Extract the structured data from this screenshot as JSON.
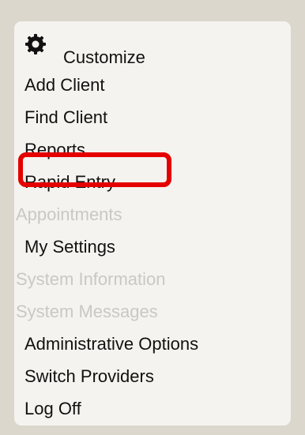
{
  "menu": {
    "customize": {
      "label": "Customize",
      "icon": "gear-icon"
    },
    "items": [
      {
        "label": "Add Client",
        "enabled": true
      },
      {
        "label": "Find Client",
        "enabled": true
      },
      {
        "label": "Reports",
        "enabled": true,
        "highlighted": true
      },
      {
        "label": "Rapid Entry",
        "enabled": true
      },
      {
        "label": "Appointments",
        "enabled": false
      },
      {
        "label": "My Settings",
        "enabled": true
      },
      {
        "label": "System Information",
        "enabled": false
      },
      {
        "label": "System Messages",
        "enabled": false
      },
      {
        "label": "Administrative Options",
        "enabled": true
      },
      {
        "label": "Switch Providers",
        "enabled": true
      },
      {
        "label": "Log Off",
        "enabled": true
      }
    ]
  },
  "colors": {
    "highlight": "#e50000",
    "enabled_text": "#111111",
    "disabled_text": "#c9c8c5",
    "panel_background": "#f5f3ef",
    "page_background": "#dcd7cc"
  }
}
